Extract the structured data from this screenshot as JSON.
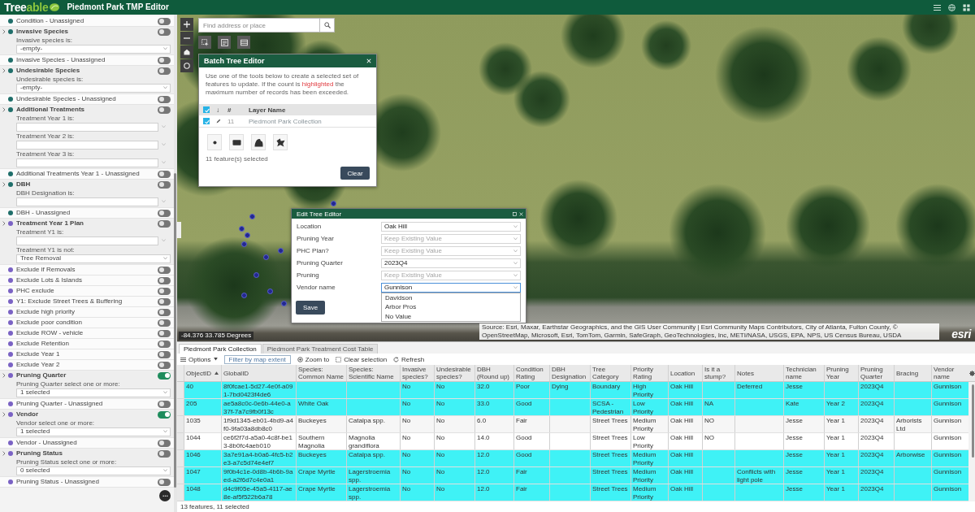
{
  "header": {
    "logo": {
      "lead": "Tree",
      "tail": "able"
    },
    "title": "Piedmont Park TMP Editor"
  },
  "sidebar": {
    "filters": [
      {
        "label": "Condition - Unassigned",
        "color": "#1f6e6a",
        "on": false,
        "expanded": false
      },
      {
        "label": "Invasive Species",
        "color": "#1f6e6a",
        "on": false,
        "expanded": true,
        "fields": [
          {
            "label": "Invasive species is:",
            "kind": "select",
            "value": "-empty-"
          }
        ]
      },
      {
        "label": "Invasive Species - Unassigned",
        "color": "#1f6e6a",
        "on": false,
        "expanded": false
      },
      {
        "label": "Undesirable Species",
        "color": "#1f6e6a",
        "on": false,
        "expanded": true,
        "fields": [
          {
            "label": "Undesirable species is:",
            "kind": "select",
            "value": "-empty-"
          }
        ]
      },
      {
        "label": "Undesirable Species - Unassigned",
        "color": "#1f6e6a",
        "on": false,
        "expanded": false
      },
      {
        "label": "Additional Treatments",
        "color": "#1f6e6a",
        "on": false,
        "expanded": true,
        "fields": [
          {
            "label": "Treatment Year 1 is:",
            "kind": "input"
          },
          {
            "label": "Treatment Year 2 is:",
            "kind": "input"
          },
          {
            "label": "Treatment Year 3 is:",
            "kind": "input"
          }
        ]
      },
      {
        "label": "Additional Treatments Year 1 - Unassigned",
        "color": "#1f6e6a",
        "on": false,
        "expanded": false
      },
      {
        "label": "DBH",
        "color": "#1f6e6a",
        "on": false,
        "expanded": true,
        "fields": [
          {
            "label": "DBH Designation is:",
            "kind": "input"
          }
        ]
      },
      {
        "label": "DBH - Unassigned",
        "color": "#1f6e6a",
        "on": false,
        "expanded": false
      },
      {
        "label": "Treatment Year 1 Plan",
        "color": "#7a62c4",
        "on": false,
        "expanded": true,
        "fields": [
          {
            "label": "Treatment Y1 is:",
            "kind": "input"
          },
          {
            "label": "Treatment Y1 is not:",
            "kind": "select",
            "value": "Tree Removal"
          }
        ]
      },
      {
        "label": "Exclude if Removals",
        "color": "#7a62c4",
        "on": false,
        "expanded": false
      },
      {
        "label": "Exclude Lots & Islands",
        "color": "#7a62c4",
        "on": false,
        "expanded": false
      },
      {
        "label": "PHC exclude",
        "color": "#7a62c4",
        "on": false,
        "expanded": false
      },
      {
        "label": "Y1: Exclude Street Trees & Buffering",
        "color": "#7a62c4",
        "on": false,
        "expanded": false
      },
      {
        "label": "Exclude high priority",
        "color": "#7a62c4",
        "on": false,
        "expanded": false
      },
      {
        "label": "Exclude poor condition",
        "color": "#7a62c4",
        "on": false,
        "expanded": false
      },
      {
        "label": "Exclude ROW - vehicle",
        "color": "#7a62c4",
        "on": false,
        "expanded": false
      },
      {
        "label": "Exclude Retention",
        "color": "#7a62c4",
        "on": false,
        "expanded": false
      },
      {
        "label": "Exclude Year 1",
        "color": "#7a62c4",
        "on": false,
        "expanded": false
      },
      {
        "label": "Exclude Year 2",
        "color": "#7a62c4",
        "on": false,
        "expanded": false
      },
      {
        "label": "Pruning Quarter",
        "color": "#7a62c4",
        "on": true,
        "expanded": true,
        "fields": [
          {
            "label": "Pruning Quarter select one or more:",
            "kind": "select",
            "value": "1 selected"
          }
        ]
      },
      {
        "label": "Pruning Quarter - Unassigned",
        "color": "#7a62c4",
        "on": false,
        "expanded": false
      },
      {
        "label": "Vendor",
        "color": "#7a62c4",
        "on": true,
        "expanded": true,
        "fields": [
          {
            "label": "Vendor select one or more:",
            "kind": "select",
            "value": "1 selected"
          }
        ]
      },
      {
        "label": "Vendor - Unassigned",
        "color": "#7a62c4",
        "on": false,
        "expanded": false
      },
      {
        "label": "Pruning Status",
        "color": "#7a62c4",
        "on": false,
        "expanded": true,
        "fields": [
          {
            "label": "Pruning Status select one or more:",
            "kind": "select",
            "value": "0 selected"
          }
        ]
      },
      {
        "label": "Pruning Status - Unassigned",
        "color": "#7a62c4",
        "on": false,
        "expanded": false
      }
    ]
  },
  "map": {
    "search": {
      "placeholder": "Find address or place"
    },
    "coordinates": "-84.376 33.785 Degrees",
    "attribution": "Source: Esri, Maxar, Earthstar Geographics, and the GIS User Community | Esri Community Maps Contributors, City of Atlanta, Fulton County, © OpenStreetMap, Microsoft, Esri, TomTom, Garmin, SafeGraph, GeoTechnologies, Inc, METI/NASA, USGS, EPA, NPS, US Census Bureau, USDA",
    "logo": "esri"
  },
  "batch_editor": {
    "title": "Batch Tree Editor",
    "intro": "Use one of the tools below to create a selected set of features to update. If the count is **highlighted** the maximum number of records has been exceeded.",
    "layer_header": {
      "checked": true,
      "columns": [
        "↓",
        "#",
        "Layer Name"
      ]
    },
    "layers": [
      {
        "checked": true,
        "count": "11",
        "name": "Piedmont Park Collection"
      }
    ],
    "selection_status": "11 feature(s) selected",
    "button": "Clear"
  },
  "edit_form": {
    "title": "Edit Tree Editor",
    "fields": [
      {
        "label": "Location",
        "value": "Oak Hill",
        "open": false
      },
      {
        "label": "Pruning Year",
        "placeholder": "Keep Existing Value",
        "open": false
      },
      {
        "label": "PHC Plan?",
        "placeholder": "Keep Existing Value",
        "open": false
      },
      {
        "label": "Pruning Quarter",
        "value": "2023Q4",
        "open": false
      },
      {
        "label": "Pruning",
        "placeholder": "Keep Existing Value",
        "open": false
      },
      {
        "label": "Vendor name",
        "value": "Gunnison",
        "open": true,
        "options": [
          "Davidson",
          "Arbor Pros",
          "No Value"
        ]
      }
    ],
    "button": "Save"
  },
  "attribute_table": {
    "tabs": [
      {
        "label": "Piedmont Park Collection",
        "selected": true
      },
      {
        "label": "Piedmont Park Treatment Cost Table",
        "selected": false
      }
    ],
    "toolbar": [
      {
        "kind": "menu",
        "label": "Options"
      },
      {
        "kind": "filter",
        "label": "Filter by map extent"
      },
      {
        "kind": "zoom",
        "label": "Zoom to"
      },
      {
        "kind": "clear",
        "label": "Clear selection"
      },
      {
        "kind": "refresh",
        "label": "Refresh"
      }
    ],
    "columns": [
      {
        "label": "ObjectID",
        "sorted": true
      },
      {
        "label": "GlobalID",
        "sorted": false
      },
      {
        "label": "Species: Common Name",
        "sorted": false
      },
      {
        "label": "Species: Scientific Name",
        "sorted": false
      },
      {
        "label": "Invasive species?",
        "sorted": false
      },
      {
        "label": "Undesirable species?",
        "sorted": false
      },
      {
        "label": "DBH (Round up)",
        "sorted": false
      },
      {
        "label": "Condition Rating",
        "sorted": false
      },
      {
        "label": "DBH Designation",
        "sorted": false
      },
      {
        "label": "Tree Category",
        "sorted": false
      },
      {
        "label": "Priority Rating",
        "sorted": false
      },
      {
        "label": "Location",
        "sorted": false
      },
      {
        "label": "Is it a stump?",
        "sorted": false
      },
      {
        "label": "Notes",
        "sorted": false
      },
      {
        "label": "Technician name",
        "sorted": false
      },
      {
        "label": "Pruning Year",
        "sorted": false
      },
      {
        "label": "Pruning Quarter",
        "sorted": false
      },
      {
        "label": "Bracing",
        "sorted": false
      },
      {
        "label": "Vendor name",
        "sorted": false
      }
    ],
    "rows": [
      {
        "selected": true,
        "cells": [
          "40",
          "8f0fcae1-5d27-4e0f-a091-7bd0423f4de6",
          null,
          null,
          "No",
          "No",
          "32.0",
          "Poor",
          "Dying",
          "Boundary",
          "High Priority",
          "Oak Hill",
          null,
          "Deferred",
          "Jesse",
          null,
          "2023Q4",
          null,
          "Gunnison"
        ]
      },
      {
        "selected": true,
        "cells": [
          "205",
          "ae5a8c0c-0e6b-44e0-a37f-7a7c9fb0f13c",
          "White Oak",
          null,
          "No",
          "No",
          "33.0",
          "Good",
          null,
          "SCSA - Pedestrian",
          "Low Priority",
          "Oak Hill",
          "NA",
          null,
          "Kate",
          "Year 2",
          "2023Q4",
          null,
          "Gunnison"
        ]
      },
      {
        "selected": false,
        "cells": [
          "1035",
          "1f9d1345-eb01-4bd9-a4f0-9fa03a8db8c0",
          "Buckeyes",
          "Catalpa spp.",
          "No",
          "No",
          "6.0",
          "Fair",
          null,
          "Street Trees",
          "Medium Priority",
          "Oak Hill",
          "NO",
          null,
          "Jesse",
          "Year 1",
          "2023Q4",
          "Arborists Ltd",
          "Gunnison"
        ]
      },
      {
        "selected": false,
        "cells": [
          "1044",
          "ce6f2f7d-a5a0-4c8f-be13-8b0fc4aeb010",
          "Southern Magnolia",
          "Magnolia grandiflora",
          "No",
          "No",
          "14.0",
          "Good",
          null,
          "Street Trees",
          "Low Priority",
          "Oak Hill",
          "NO",
          null,
          "Jesse",
          "Year 1",
          "2023Q4",
          null,
          "Gunnison"
        ]
      },
      {
        "selected": true,
        "cells": [
          "1046",
          "3a7e91a4-b0a6-4fc5-b2e3-a7c5d74e4ef7",
          "Buckeyes",
          "Catalpa spp.",
          "No",
          "No",
          "12.0",
          "Good",
          null,
          "Street Trees",
          "Medium Priority",
          "Oak Hill",
          null,
          null,
          "Jesse",
          "Year 1",
          "2023Q4",
          "Arborwise",
          "Gunnison"
        ]
      },
      {
        "selected": true,
        "cells": [
          "1047",
          "9f0b4c1e-0d8b-4b6b-9aed-a2f6d7c4e0a1",
          "Crape Myrtle",
          "Lagerstroemia spp.",
          "No",
          "No",
          "12.0",
          "Fair",
          null,
          "Street Trees",
          "Medium Priority",
          "Oak Hill",
          null,
          "Conflicts with light pole",
          "Jesse",
          "Year 1",
          "2023Q4",
          null,
          "Gunnison"
        ]
      },
      {
        "selected": true,
        "cells": [
          "1048",
          "d4c9f05e-45a5-4117-ae8e-af5f522b6a78",
          "Crape Myrtle",
          "Lagerstroemia spp.",
          "No",
          "No",
          "12.0",
          "Fair",
          null,
          "Street Trees",
          "Medium Priority",
          "Oak Hill",
          null,
          null,
          "Jesse",
          "Year 1",
          "2023Q4",
          null,
          "Gunnison"
        ]
      }
    ],
    "status": "13 features, 11 selected"
  }
}
